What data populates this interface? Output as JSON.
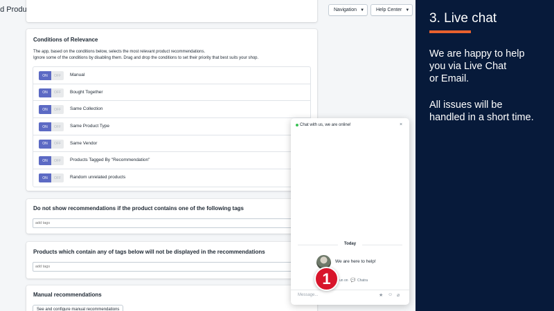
{
  "header": {
    "title": "ed Products",
    "navigation_label": "Navigation",
    "help_label": "Help Center"
  },
  "conditions": {
    "title": "Conditions of Relevance",
    "desc1": "The app, based on the conditions below, selects the most relevant product recommendations.",
    "desc2": "Ignore some of the conditions by disabling them. Drag and drop the conditions to set their priority that best suits your shop.",
    "toggle_on": "ON",
    "toggle_off": "OFF",
    "items": [
      {
        "label": "Manual",
        "state": "on"
      },
      {
        "label": "Bought Together",
        "state": "on"
      },
      {
        "label": "Same Collection",
        "state": "on"
      },
      {
        "label": "Same Product Type",
        "state": "on"
      },
      {
        "label": "Same Vendor",
        "state": "on"
      },
      {
        "label": "Products Tagged By \"Recommendation\"",
        "state": "on"
      },
      {
        "label": "Random unrelated products",
        "state": "on"
      }
    ]
  },
  "exclude_tags": {
    "title": "Do not show recommendations if the product contains one of the following tags",
    "placeholder": "add tags"
  },
  "hidden_tags": {
    "title": "Products which contain any of tags below will not be displayed in the recommendations",
    "placeholder": "add tags"
  },
  "manual": {
    "title": "Manual recommendations",
    "button": "See and configure manual recommendations"
  },
  "chat": {
    "status": "Chat with us, we are online!",
    "close": "×",
    "today": "Today",
    "agent_message": "We are here to help!",
    "powered_fragment": "un on",
    "brand": "Chatra",
    "message_placeholder": "Message...",
    "online_color": "#3ac155"
  },
  "step_badge": "1",
  "side_panel": {
    "title": "3. Live chat",
    "paragraph1": "We are happy to help\nyou via Live Chat\nor Email.",
    "paragraph2": "All issues will be\nhandled in a short time.",
    "accent": "#e8612e",
    "background": "#071a3a"
  },
  "colors": {
    "toggle_on": "#5c6ac4"
  }
}
